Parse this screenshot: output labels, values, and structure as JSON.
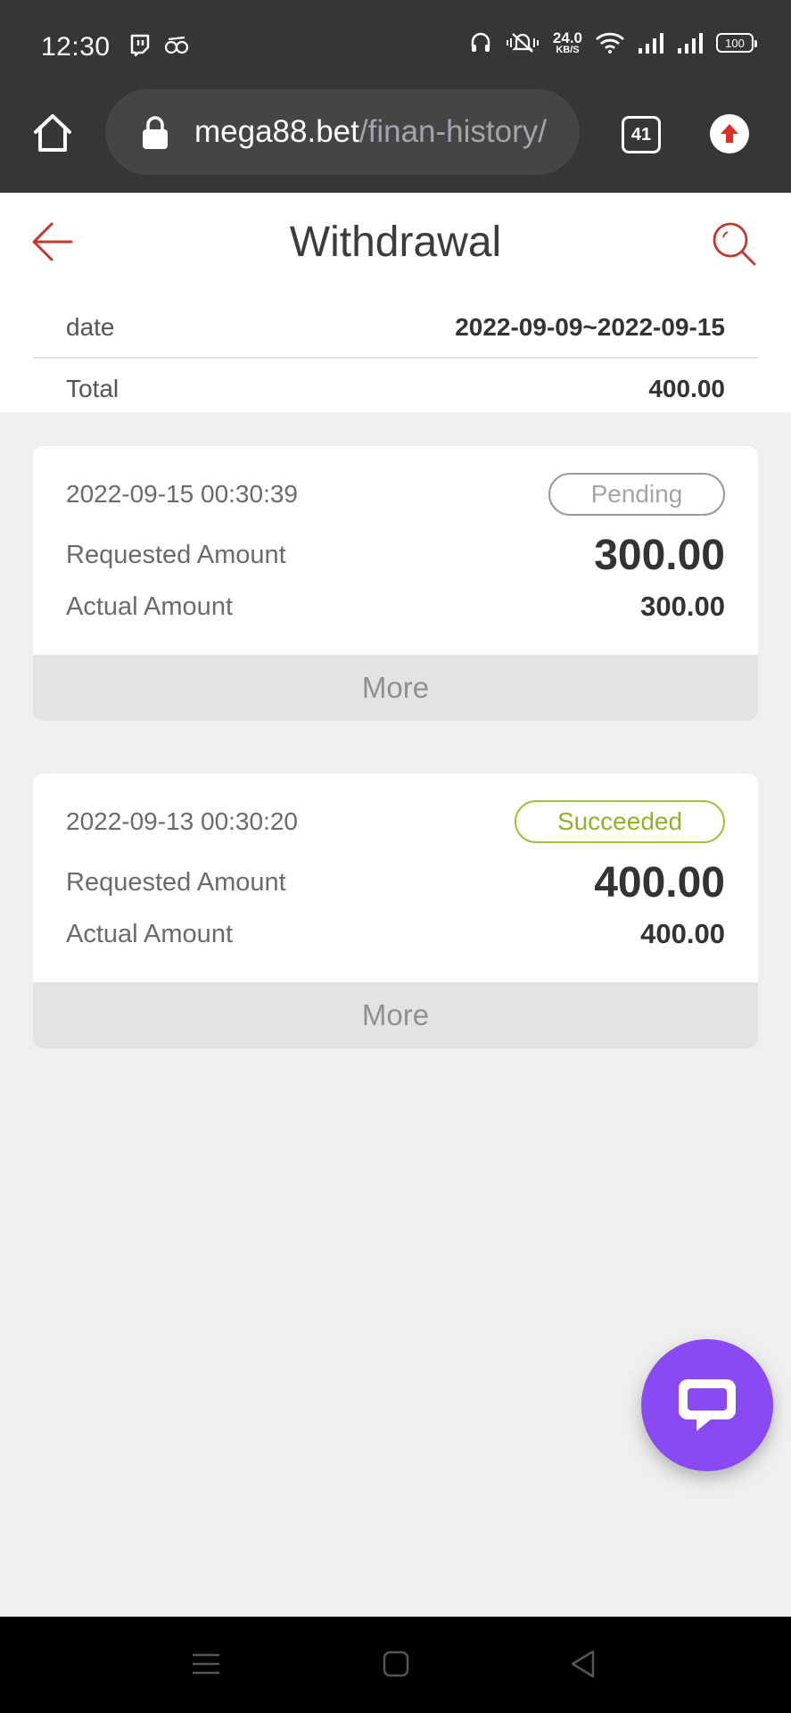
{
  "status_bar": {
    "time": "12:30",
    "net_speed_value": "24.0",
    "net_speed_unit": "KB/S",
    "battery": "100"
  },
  "browser": {
    "url_host": "mega88.bet",
    "url_path": "/finan-history/",
    "tab_count": "41"
  },
  "header": {
    "title": "Withdrawal",
    "date_label": "date",
    "date_value": "2022-09-09~2022-09-15",
    "total_label": "Total",
    "total_value": "400.00"
  },
  "records": [
    {
      "timestamp": "2022-09-15 00:30:39",
      "status": "Pending",
      "requested_label": "Requested Amount",
      "requested_value": "300.00",
      "actual_label": "Actual Amount",
      "actual_value": "300.00",
      "more_label": "More"
    },
    {
      "timestamp": "2022-09-13 00:30:20",
      "status": "Succeeded",
      "requested_label": "Requested Amount",
      "requested_value": "400.00",
      "actual_label": "Actual Amount",
      "actual_value": "400.00",
      "more_label": "More"
    }
  ],
  "colors": {
    "accent_red": "#c0392b",
    "pending_border": "#9a9a9a",
    "succeeded_border": "#9ec138",
    "chat_fab": "#8a4af3"
  },
  "icons": {
    "back": "arrow-left-icon",
    "search": "search-icon",
    "chat": "chat-bubble-icon",
    "home": "home-icon",
    "lock": "lock-icon"
  }
}
